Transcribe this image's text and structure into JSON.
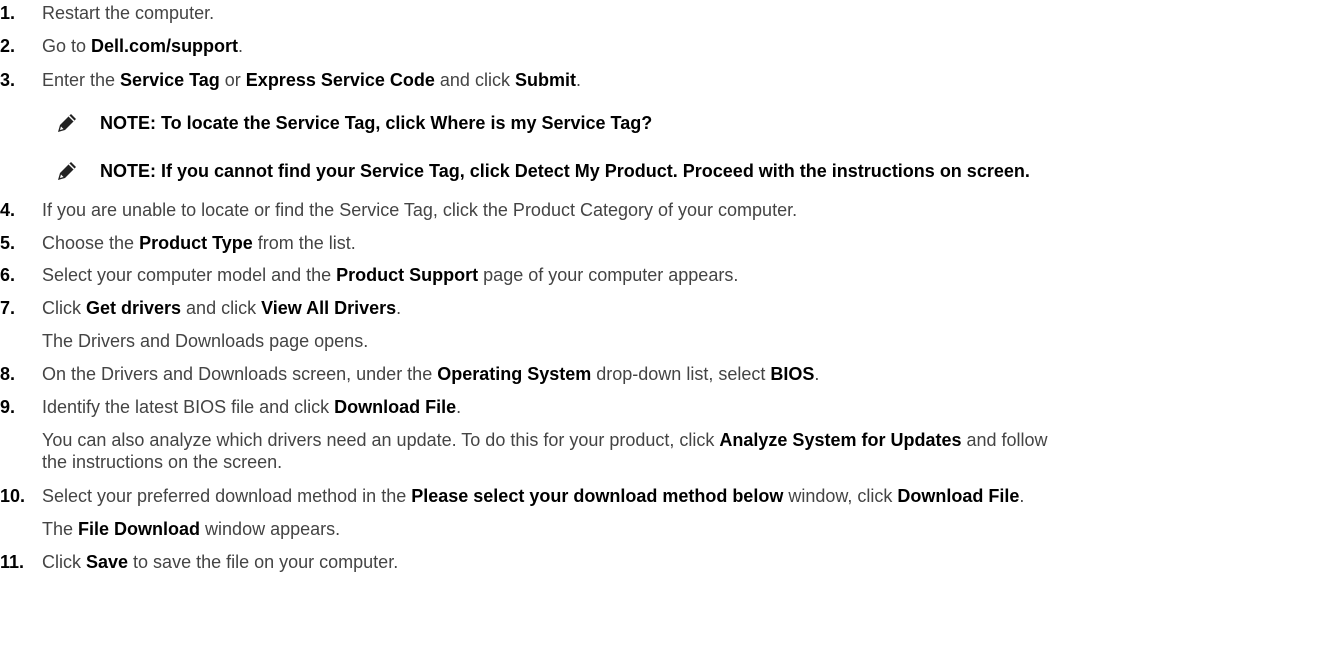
{
  "steps": [
    {
      "num": "1.",
      "parts": [
        "Restart the computer."
      ]
    },
    {
      "num": "2.",
      "parts": [
        "Go to ",
        "Dell.com/support",
        "."
      ]
    },
    {
      "num": "3.",
      "parts": [
        "Enter the ",
        "Service Tag",
        " or ",
        "Express Service Code",
        " and click ",
        "Submit",
        "."
      ]
    },
    {
      "num": "4.",
      "parts": [
        "If you are unable to locate or find the Service Tag, click the Product Category of your computer."
      ]
    },
    {
      "num": "5.",
      "parts": [
        "Choose the ",
        "Product Type",
        " from the list."
      ]
    },
    {
      "num": "6.",
      "parts": [
        "Select your computer model and the ",
        "Product Support",
        " page of your computer appears."
      ]
    },
    {
      "num": "7.",
      "parts": [
        "Click ",
        "Get drivers",
        " and click ",
        "View All Drivers",
        "."
      ]
    },
    {
      "num": "8.",
      "parts": [
        "On the Drivers and Downloads screen, under the ",
        "Operating System",
        " drop-down list, select ",
        "BIOS",
        "."
      ]
    },
    {
      "num": "9.",
      "parts": [
        "Identify the latest BIOS file and click ",
        "Download File",
        "."
      ]
    },
    {
      "num": "10.",
      "parts": [
        "Select your preferred download method in the ",
        "Please select your download method below",
        " window, click ",
        "Download File",
        "."
      ]
    },
    {
      "num": "11.",
      "parts": [
        "Click ",
        "Save",
        " to save the file on your computer."
      ]
    }
  ],
  "notes": [
    "NOTE: To locate the Service Tag, click Where is my Service Tag?",
    "NOTE: If you cannot find your Service Tag, click Detect My Product. Proceed with the instructions on screen."
  ],
  "sub": {
    "step7": "The Drivers and Downloads page opens.",
    "step9_line1_a": "You can also analyze which drivers need an update. To do this for your product, click ",
    "step9_line1_b": "Analyze System for Updates",
    "step9_line1_c": " and follow",
    "step9_line2": "the instructions on the screen.",
    "step10_a": "The ",
    "step10_b": "File Download",
    "step10_c": " window appears."
  },
  "icons": {
    "note": "note-pencil-icon"
  }
}
